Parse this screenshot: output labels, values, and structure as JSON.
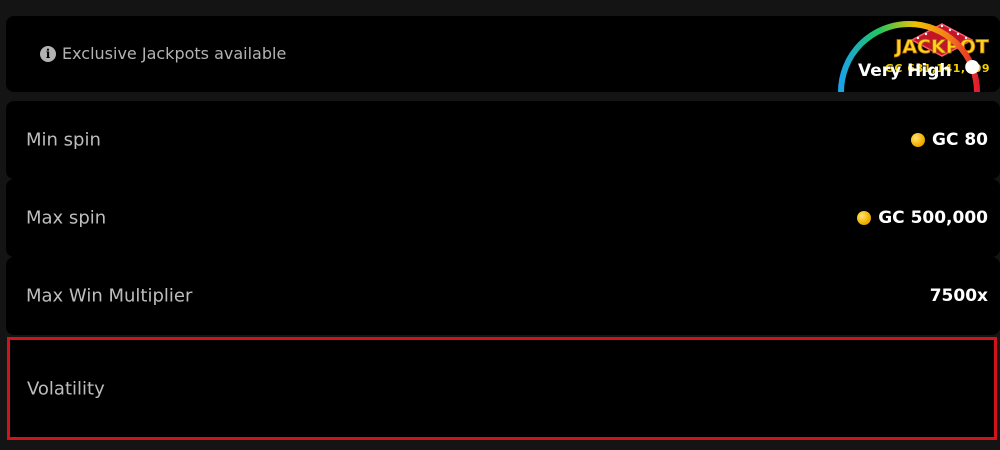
{
  "jackpot": {
    "info_text": "Exclusive Jackpots available",
    "badge_label": "JACKPOT",
    "amount": "GC 681,141,409"
  },
  "rows": [
    {
      "label": "Min spin",
      "value": "GC 80",
      "coin": true
    },
    {
      "label": "Max spin",
      "value": "GC 500,000",
      "coin": true
    },
    {
      "label": "Max Win Multiplier",
      "value": "7500x",
      "coin": false
    }
  ],
  "volatility": {
    "label": "Volatility",
    "value": "Very High",
    "level_fraction": 1.0
  },
  "colors": {
    "background": "#141414",
    "card": "#000000",
    "highlight_border": "#d0141b",
    "coin": "#f4b400",
    "jackpot_gold": "#f5d000"
  },
  "icons": {
    "info": "info-circle-icon",
    "coin": "gold-coin-icon"
  }
}
